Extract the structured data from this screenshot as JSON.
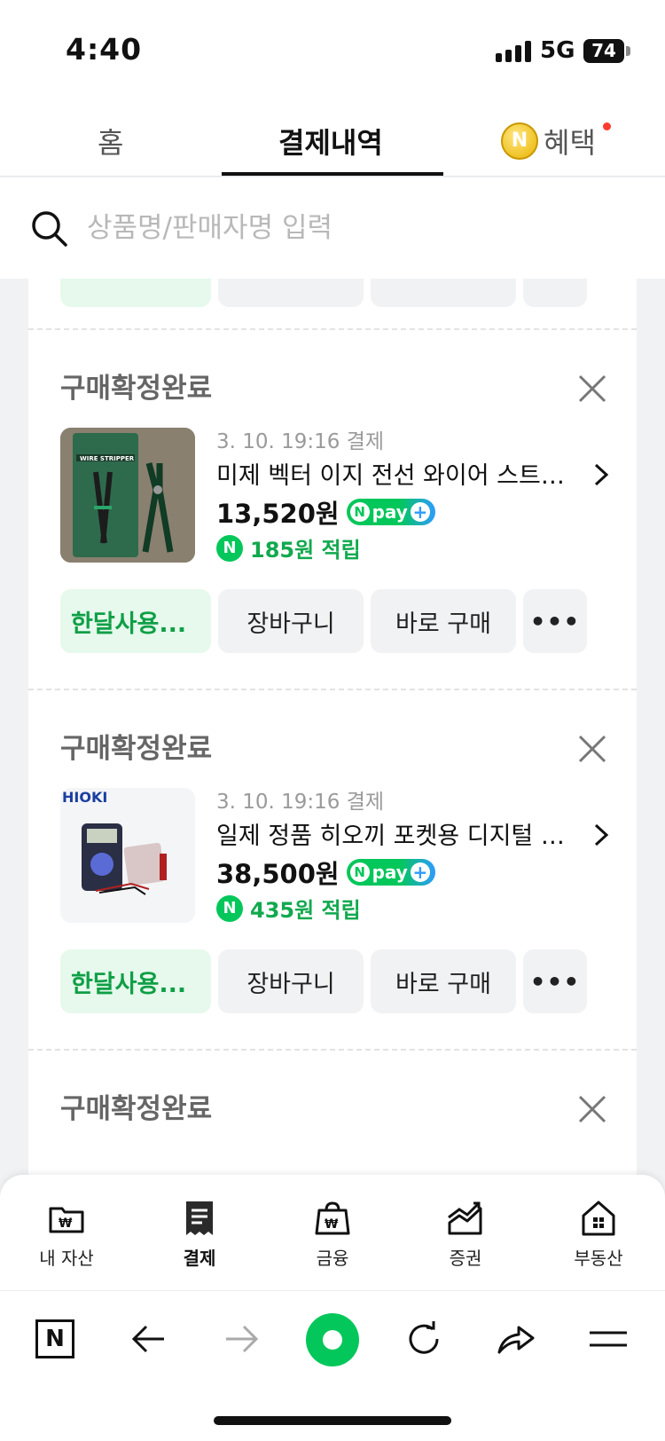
{
  "status_bar": {
    "time": "4:40",
    "network": "5G",
    "battery": "74"
  },
  "tabs": {
    "home": "홈",
    "payments": "결제내역",
    "benefits": "혜택",
    "benefit_coin": "N"
  },
  "search": {
    "placeholder": "상품명/판매자명 입력"
  },
  "orders": [
    {
      "status": "구매확정완료",
      "date": "3. 10. 19:16 결제",
      "title": "미제 벡터 이지 전선 와이어 스트리...",
      "price": "13,520원",
      "npay_label": "pay",
      "points": "185원 적립",
      "thumb_text": "WIRE STRIPPER",
      "buttons": {
        "monthly": "한달사용...",
        "cart": "장바구니",
        "buy": "바로 구매",
        "more": "•••"
      }
    },
    {
      "status": "구매확정완료",
      "date": "3. 10. 19:16 결제",
      "title": "일제 정품 히오끼 포켓용 디지털 멀...",
      "price": "38,500원",
      "npay_label": "pay",
      "points": "435원 적립",
      "thumb_text": "HIOKI",
      "buttons": {
        "monthly": "한달사용...",
        "cart": "장바구니",
        "buy": "바로 구매",
        "more": "•••"
      }
    },
    {
      "status": "구매확정완료"
    }
  ],
  "bottom_nav": [
    {
      "label": "내 자산",
      "icon": "wallet-folder-icon"
    },
    {
      "label": "결제",
      "icon": "receipt-icon"
    },
    {
      "label": "금융",
      "icon": "finance-bag-icon"
    },
    {
      "label": "증권",
      "icon": "stock-chart-icon"
    },
    {
      "label": "부동산",
      "icon": "house-icon"
    }
  ],
  "browser_bar": {
    "home_letter": "N"
  },
  "colors": {
    "naver_green": "#03c75a",
    "points_green": "#12a94e",
    "npay_blue": "#2d9bff"
  }
}
